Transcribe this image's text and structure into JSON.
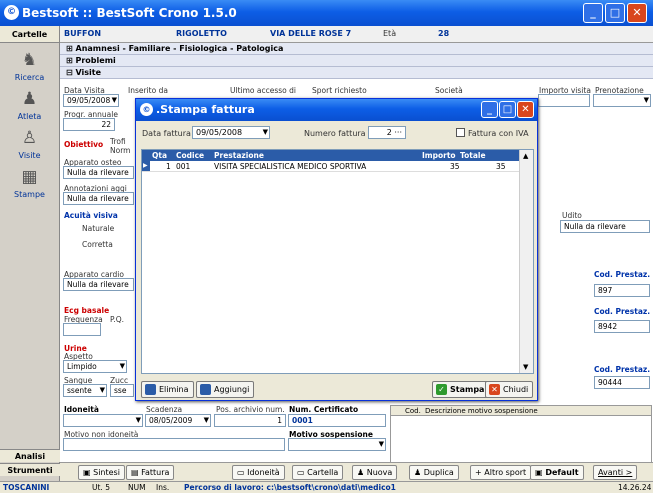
{
  "window": {
    "title": "Bestsoft :: BestSoft Crono 1.5.0"
  },
  "sidebar": {
    "header": "Cartelle",
    "items": [
      {
        "label": "Ricerca"
      },
      {
        "label": "Atleta"
      },
      {
        "label": "Visite"
      },
      {
        "label": "Stampe"
      }
    ],
    "analisi": "Analisi",
    "strumenti": "Strumenti"
  },
  "patient": {
    "surname": "BUFFON",
    "name": "RIGOLETTO",
    "address": "VIA DELLE ROSE 7",
    "age_label": "Età",
    "age": "28"
  },
  "sections": {
    "anamnesi": "Anamnesi - Familiare - Fisiologica - Patologica",
    "problemi": "Problemi",
    "visite": "Visite"
  },
  "visit": {
    "data_visita_label": "Data Visita",
    "data_visita": "09/05/2008",
    "inserito_label": "Inserito da",
    "ultimo_label": "Ultimo accesso di",
    "sport_label": "Sport richiesto",
    "societa_label": "Società",
    "importo_label": "Importo visita",
    "prenotazione_label": "Prenotazione",
    "progr_label": "Progr. annuale",
    "progr_value": "22",
    "obiettivo": "Obiettivo",
    "trofismo": "Trofi",
    "norm": "Norm",
    "apparato_osteo_label": "Apparato osteo",
    "nulla_da_rilevare": "Nulla da rilevare",
    "annotazioni_label": "Annotazioni aggi",
    "acuita_label": "Acuità visiva",
    "naturale": "Naturale",
    "corretta": "Corretta",
    "udito_label": "Udito",
    "apparato_cardio_label": "Apparato cardio",
    "ecg_label": "Ecg basale",
    "frequenza": "Frequenza",
    "pq": "P.Q.",
    "urine_label": "Urine",
    "aspetto_label": "Aspetto",
    "aspetto_value": "Limpido",
    "sangue_label": "Sangue",
    "zucc_label": "Zucc",
    "assente": "ssente",
    "sse": "sse",
    "cod_prestaz_label": "Cod. Prestaz.",
    "cod1": "897",
    "cod2": "8942",
    "cod3": "90444",
    "idoneita_label": "Idoneità",
    "scadenza_label": "Scadenza",
    "scadenza": "08/05/2009",
    "pos_archivio_label": "Pos. archivio num.",
    "pos_archivio": "1",
    "num_cert_label": "Num. Certificato",
    "num_cert": "0001",
    "motivo_non_label": "Motivo non idoneità",
    "motivo_sosp_label": "Motivo sospensione",
    "cod_label": "Cod.",
    "desc_sosp_label": "Descrizione motivo sospensione"
  },
  "modal": {
    "title": ".Stampa fattura",
    "data_fattura_label": "Data fattura",
    "data_fattura": "09/05/2008",
    "numero_label": "Numero fattura",
    "numero": "2",
    "iva_label": "Fattura con IVA",
    "columns": [
      "Qta",
      "Codice",
      "Prestazione",
      "Importo",
      "Totale"
    ],
    "rows": [
      {
        "qta": "1",
        "codice": "001",
        "prestazione": "VISITA SPECIALISTICA MEDICO SPORTIVA",
        "importo": "35",
        "totale": "35"
      }
    ],
    "elimina": "Elimina",
    "aggiungi": "Aggiungi",
    "stampa": "Stampa",
    "chiudi": "Chiudi"
  },
  "bottom": {
    "sintesi": "Sintesi",
    "fattura": "Fattura",
    "idoneita": "Idoneità",
    "cartella": "Cartella",
    "nuova": "Nuova",
    "duplica": "Duplica",
    "altro_sport": "+ Altro sport",
    "default": "Default",
    "avanti": "Avanti >"
  },
  "status": {
    "user": "TOSCANINI",
    "ut": "Ut. 5",
    "num": "NUM",
    "ins": "Ins.",
    "path": "Percorso di lavoro: c:\\bestsoft\\crono\\dati\\medico1",
    "time": "14.26.24"
  }
}
